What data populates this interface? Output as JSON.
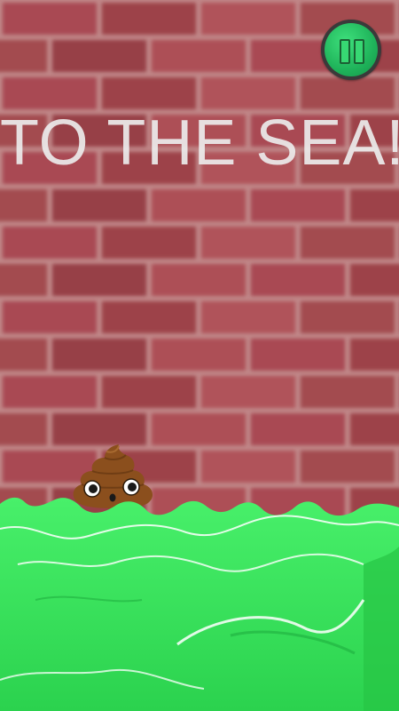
{
  "game": {
    "title_text": "TO THE SEA!!",
    "pause_icon": "pause-icon",
    "character_icon": "poop-emoji-icon"
  },
  "colors": {
    "brick": "#a24a4f",
    "mortar": "#c98f8e",
    "sea": "#33e85a",
    "sea_dark": "#1fae3c",
    "button_green": "#1fb35a",
    "poop_brown": "#8a4f1c"
  }
}
